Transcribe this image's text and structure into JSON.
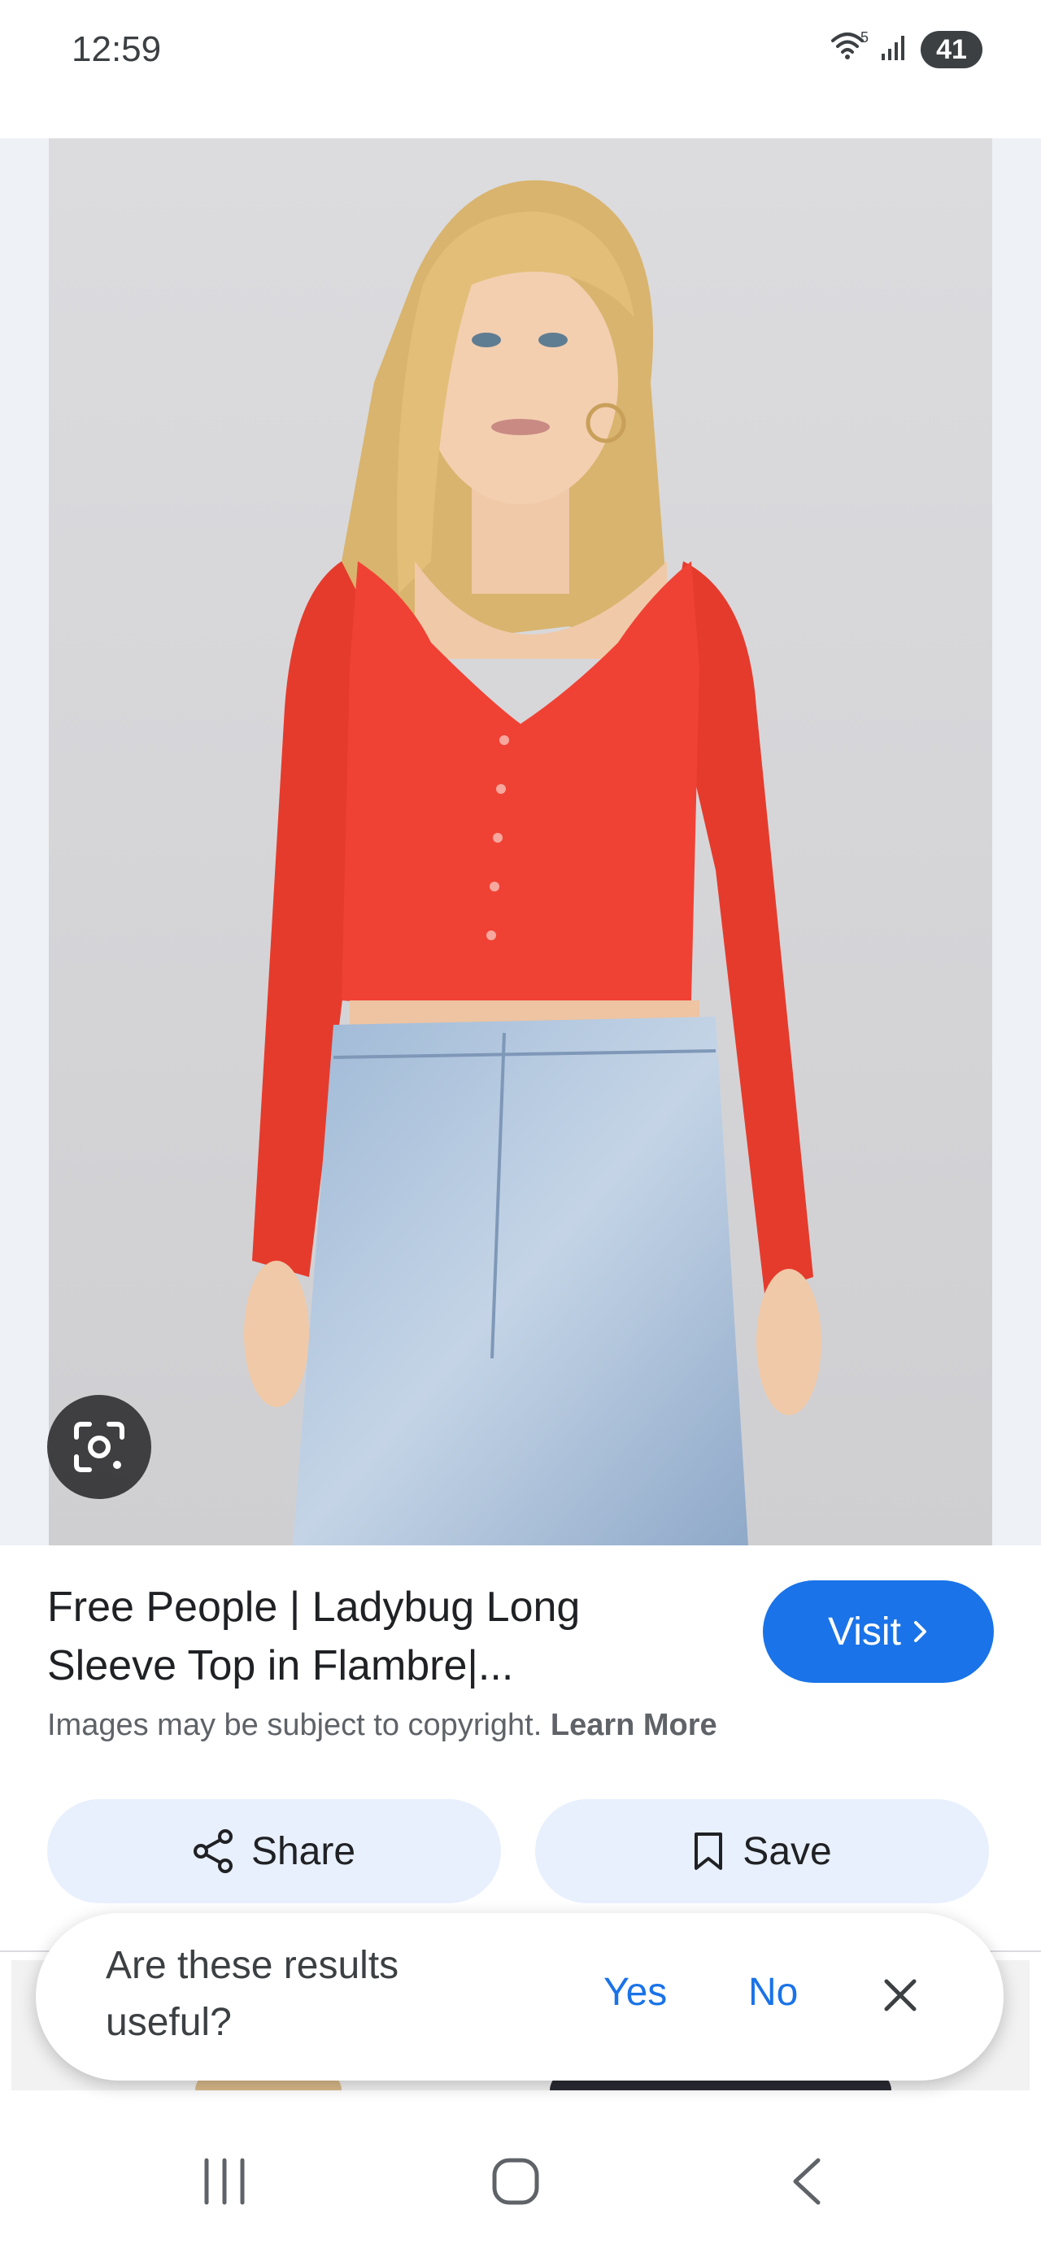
{
  "status_bar": {
    "time": "12:59",
    "wifi_label": "5",
    "battery": "41"
  },
  "image": {
    "description_icon": "google-lens-icon"
  },
  "result": {
    "title": "Free People | Ladybug Long Sleeve Top in Flambre|...",
    "visit_label": "Visit",
    "copyright_text": "Images may be subject to copyright.",
    "learn_more": "Learn More"
  },
  "actions": {
    "share_label": "Share",
    "save_label": "Save"
  },
  "feedback": {
    "question": "Are these results useful?",
    "yes_label": "Yes",
    "no_label": "No"
  },
  "colors": {
    "accent": "#1a73e8",
    "chip_bg": "#e8f0fe"
  }
}
